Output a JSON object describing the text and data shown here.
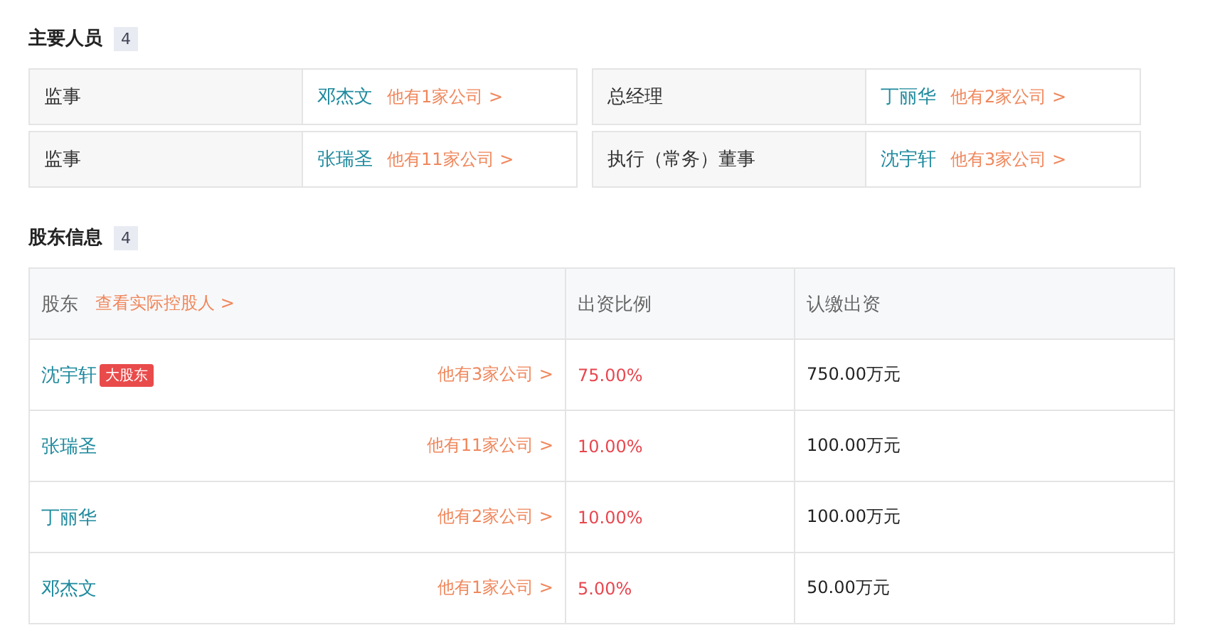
{
  "personnel": {
    "title": "主要人员",
    "count": "4",
    "items": [
      {
        "role": "监事",
        "name": "邓杰文",
        "companies": "他有1家公司 >"
      },
      {
        "role": "总经理",
        "name": "丁丽华",
        "companies": "他有2家公司 >"
      },
      {
        "role": "监事",
        "name": "张瑞圣",
        "companies": "他有11家公司 >"
      },
      {
        "role": "执行（常务）董事",
        "name": "沈宇轩",
        "companies": "他有3家公司 >"
      }
    ]
  },
  "shareholders": {
    "title": "股东信息",
    "count": "4",
    "columns": [
      "股东",
      "出资比例",
      "认缴出资"
    ],
    "controller_link": "查看实际控股人 >",
    "rows": [
      {
        "name": "沈宇轩",
        "tag": "大股东",
        "companies": "他有3家公司 >",
        "ratio": "75.00%",
        "amount": "750.00万元"
      },
      {
        "name": "张瑞圣",
        "companies": "他有11家公司 >",
        "ratio": "10.00%",
        "amount": "100.00万元"
      },
      {
        "name": "丁丽华",
        "companies": "他有2家公司 >",
        "ratio": "10.00%",
        "amount": "100.00万元"
      },
      {
        "name": "邓杰文",
        "companies": "他有1家公司 >",
        "ratio": "5.00%",
        "amount": "50.00万元"
      }
    ]
  }
}
